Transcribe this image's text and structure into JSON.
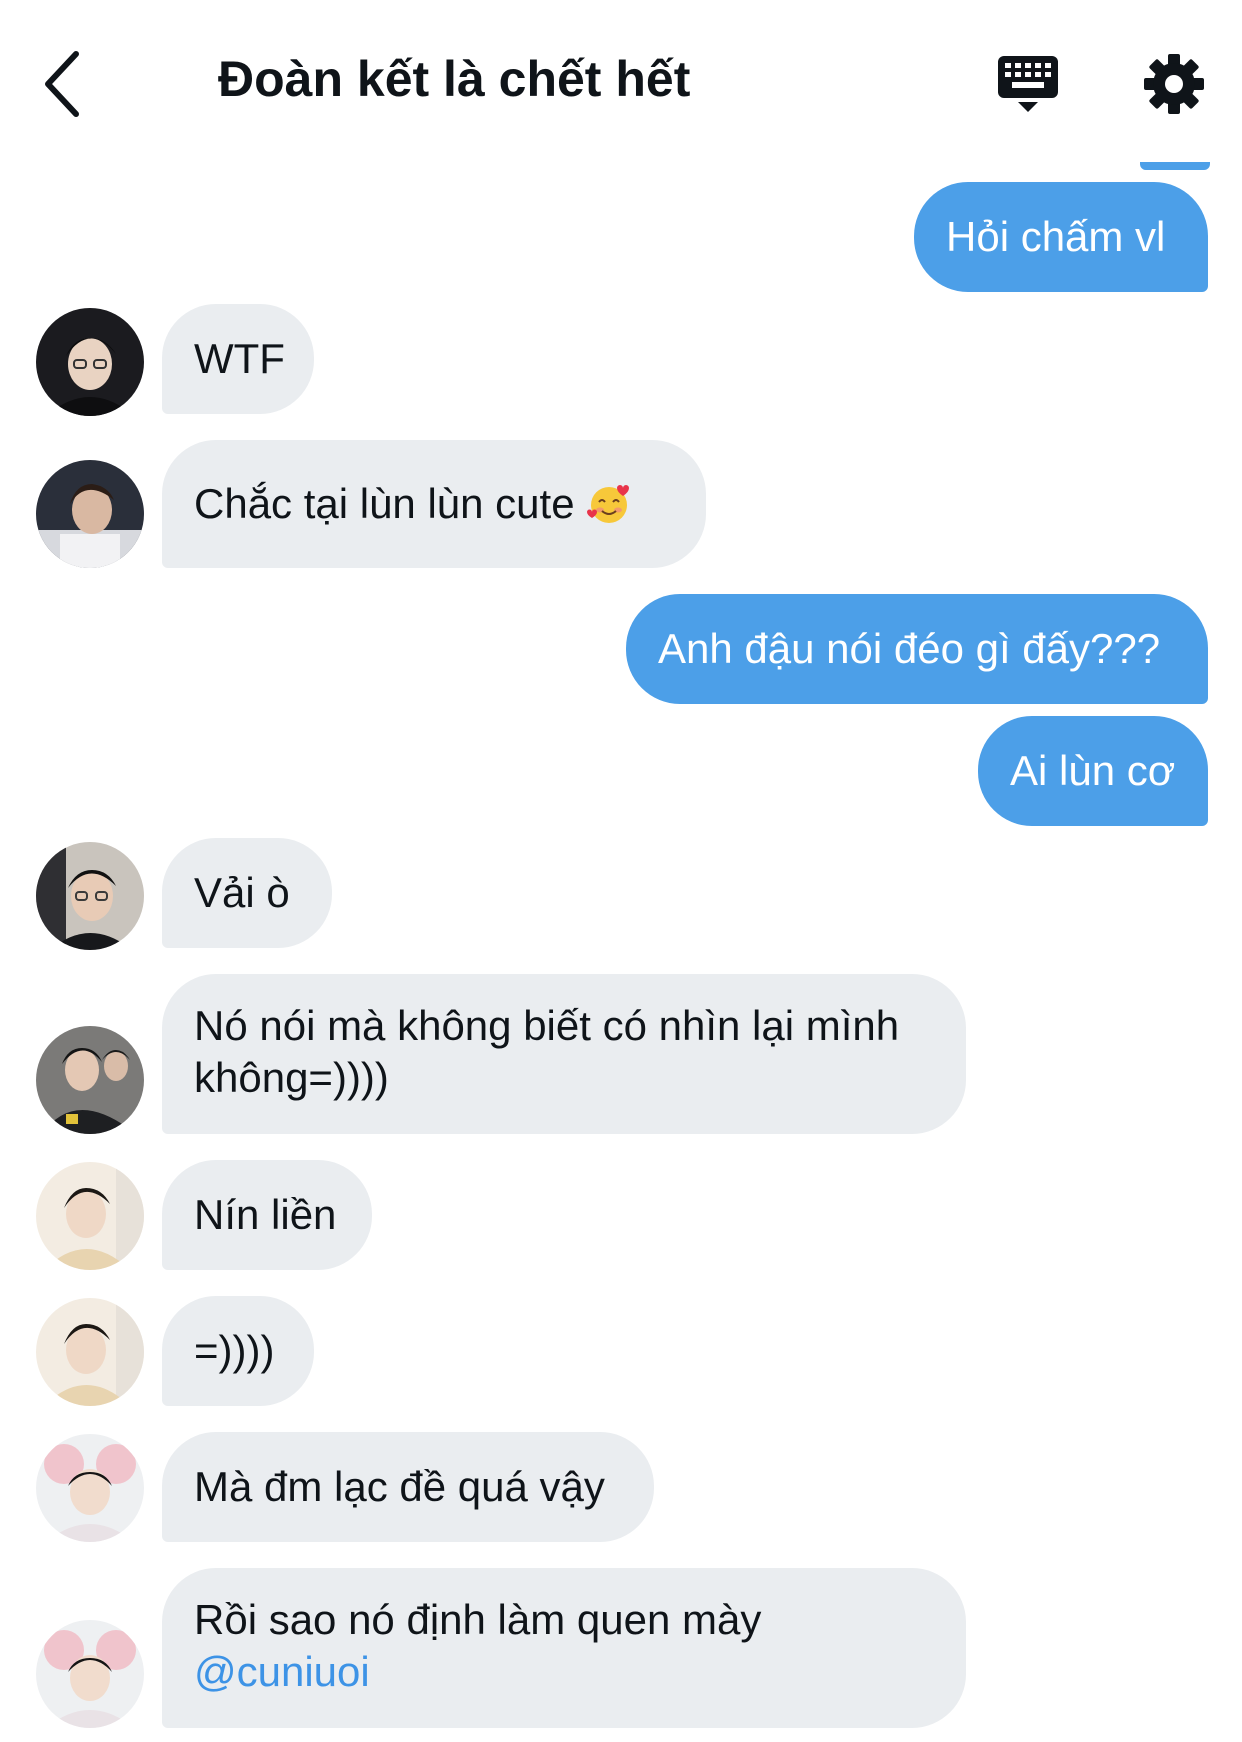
{
  "header": {
    "title": "Đoàn kết là chết hết",
    "icons": {
      "back": "chevron-left-icon",
      "keyboard": "keyboard-icon",
      "settings": "gear-icon"
    }
  },
  "colors": {
    "outgoing_bubble": "#4c9fe8",
    "incoming_bubble": "#eaedf0",
    "mention": "#3d93e6"
  },
  "messages": [
    {
      "direction": "out",
      "text": "Hỏi chấm vl"
    },
    {
      "direction": "in",
      "text": "WTF",
      "avatar": "avatar-photo-1"
    },
    {
      "direction": "in",
      "text": "Chắc tại lùn lùn cute",
      "emoji": "smiling-face-with-hearts-icon",
      "avatar": "avatar-photo-2"
    },
    {
      "direction": "out",
      "text": "Anh đậu nói đéo gì đấy???"
    },
    {
      "direction": "out",
      "text": "Ai lùn cơ"
    },
    {
      "direction": "in",
      "text": "Vải ò",
      "avatar": "avatar-photo-3"
    },
    {
      "direction": "in",
      "line1": "Nó nói mà không biết có nhìn lại mình",
      "line2": "không=))))",
      "avatar": "avatar-photo-4"
    },
    {
      "direction": "in",
      "text": "Nín liền",
      "avatar": "avatar-photo-5"
    },
    {
      "direction": "in",
      "text": "=))))",
      "avatar": "avatar-photo-5"
    },
    {
      "direction": "in",
      "text": "Mà đm lạc đề quá vậy",
      "avatar": "avatar-photo-6"
    },
    {
      "direction": "in",
      "line1": "Rồi sao nó định làm quen mày",
      "mention": "@cuniuoi",
      "avatar": "avatar-photo-6"
    }
  ]
}
